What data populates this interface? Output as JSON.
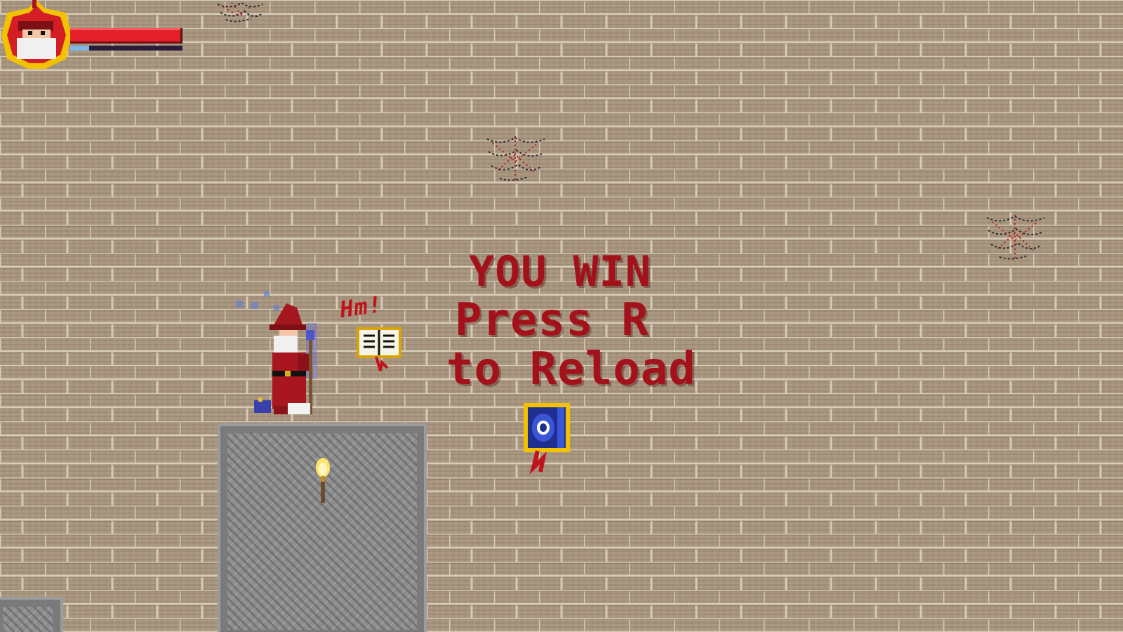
{
  "hud": {
    "player_portrait": "wizard-portrait-icon",
    "health_fraction": 0.98,
    "mana_fraction": 0.17,
    "colors": {
      "health": "#e3202c",
      "mana": "#7fb6e6",
      "frame": "#f2c200"
    }
  },
  "overlay": {
    "line1": "YOU WIN",
    "line2": "Press R",
    "line3": "to Reload",
    "color": "#a3121a"
  },
  "effects": {
    "scribble_text": "Hm!"
  },
  "icons": {
    "player": "wizard-icon",
    "spellbook": "spellbook-icon",
    "gem": "eye-gem-icon",
    "torch": "torch-icon",
    "cobweb": "cobweb-icon"
  },
  "colors": {
    "wall": "#a8957e",
    "mortar": "#cfc2ad",
    "stone": "#8e8e8e"
  }
}
